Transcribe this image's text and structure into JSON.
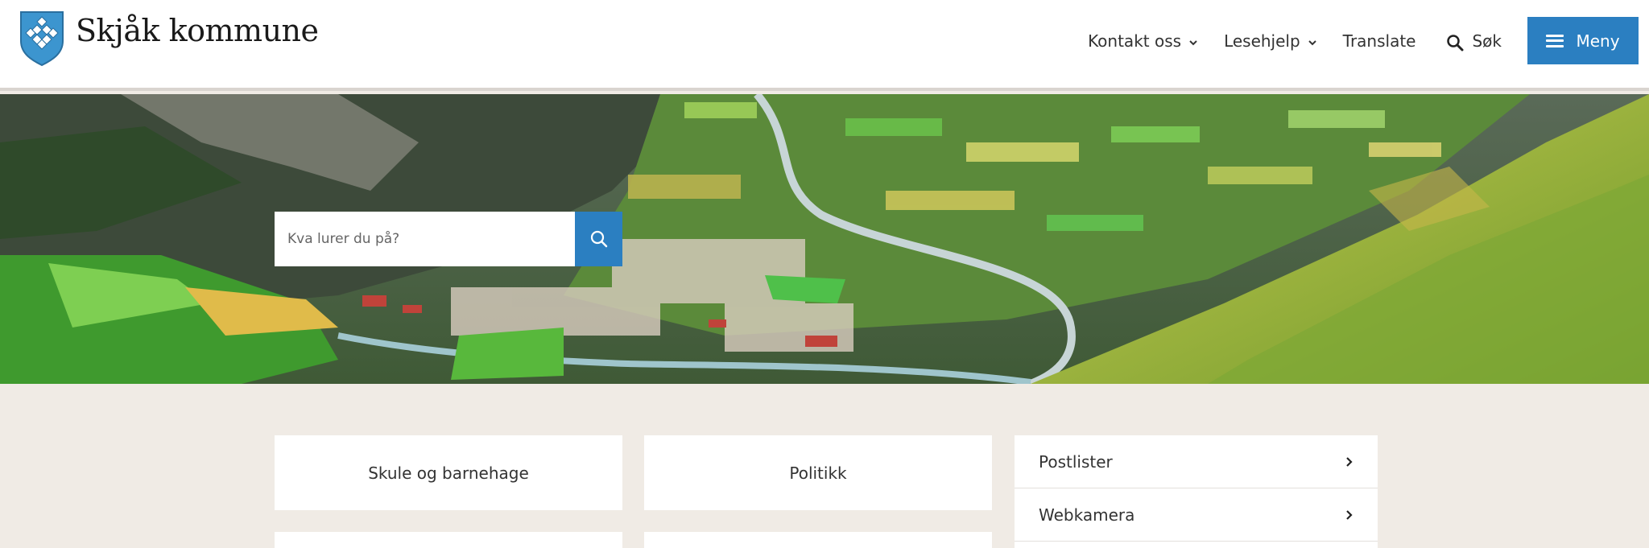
{
  "header": {
    "site_name": "Skjåk kommune",
    "logo_icon": "coat-of-arms-icon",
    "colors": {
      "accent": "#2b7fc1",
      "shield_blue": "#3c95cf"
    }
  },
  "nav": {
    "contact": "Kontakt oss",
    "reading_help": "Lesehjelp",
    "translate": "Translate",
    "search": "Søk",
    "menu": "Meny"
  },
  "hero": {
    "search_placeholder": "Kva lurer du på?"
  },
  "tiles": [
    {
      "label": "Skule og barnehage"
    },
    {
      "label": "Politikk"
    }
  ],
  "side_links": [
    {
      "label": "Postlister"
    },
    {
      "label": "Webkamera"
    }
  ]
}
